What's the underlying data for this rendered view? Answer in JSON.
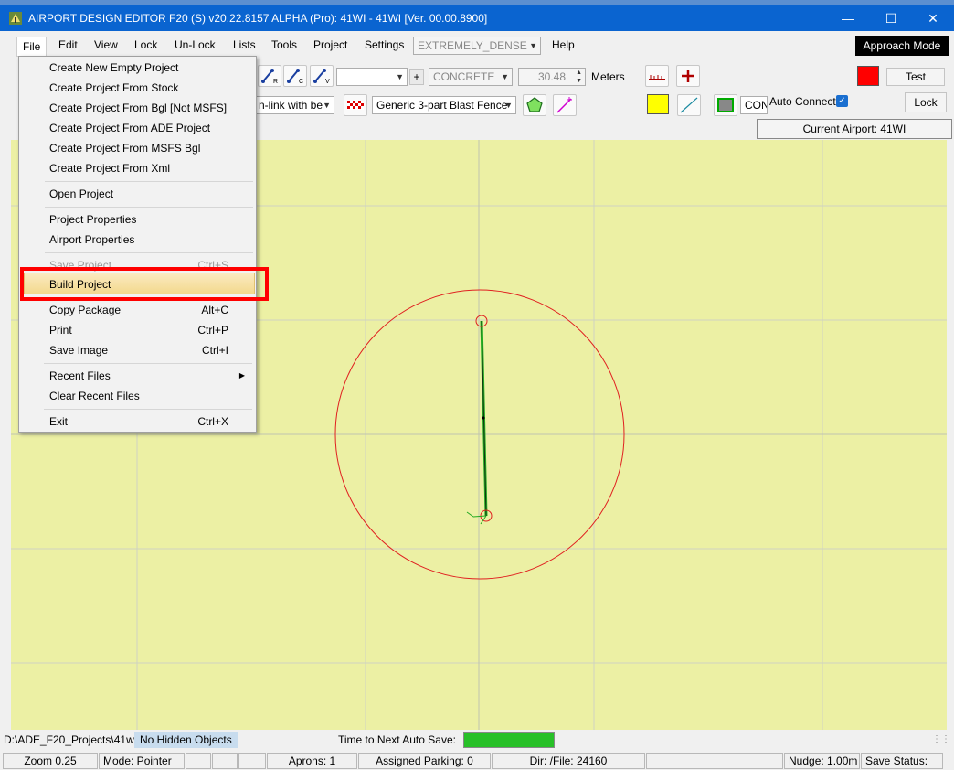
{
  "window": {
    "title": "AIRPORT DESIGN EDITOR F20 (S)  v20.22.8157 ALPHA (Pro): 41WI - 41WI [Ver. 00.00.8900]",
    "minimize": "—",
    "maximize": "☐",
    "close": "✕"
  },
  "menubar": {
    "items": [
      "File",
      "Edit",
      "View",
      "Lock",
      "Un-Lock",
      "Lists",
      "Tools",
      "Project",
      "Settings",
      "Help"
    ],
    "density_value": "EXTREMELY_DENSE",
    "approach_mode": "Approach Mode"
  },
  "toolbar": {
    "link_r": "R",
    "link_c": "C",
    "link_v": "V",
    "plus": "+",
    "surface": "CONCRETE",
    "width_value": "30.48",
    "units": "Meters",
    "test": "Test",
    "unlink_text": "n-link with be",
    "fence_type": "Generic 3-part Blast Fence",
    "con_text": "CONC",
    "auto_connect": "Auto Connect",
    "auto_connect_checked": true,
    "lock": "Lock",
    "current_airport": "Current Airport: 41WI",
    "color_swatch": "#ff0000",
    "yellow_swatch": "#ffff00"
  },
  "file_menu": {
    "items": [
      {
        "label": "Create New Empty Project",
        "shortcut": ""
      },
      {
        "label": "Create Project From Stock",
        "shortcut": ""
      },
      {
        "label": "Create Project From Bgl [Not MSFS]",
        "shortcut": ""
      },
      {
        "label": "Create Project From ADE Project",
        "shortcut": ""
      },
      {
        "label": "Create Project From MSFS Bgl",
        "shortcut": ""
      },
      {
        "label": "Create Project From Xml",
        "shortcut": ""
      },
      {
        "label": "Open Project",
        "shortcut": ""
      },
      {
        "label": "Project Properties",
        "shortcut": ""
      },
      {
        "label": "Airport Properties",
        "shortcut": ""
      },
      {
        "label": "Save  Project",
        "shortcut": "Ctrl+S"
      },
      {
        "label": "Build Project",
        "shortcut": ""
      },
      {
        "label": "Copy Package",
        "shortcut": "Alt+C"
      },
      {
        "label": "Print",
        "shortcut": "Ctrl+P"
      },
      {
        "label": "Save Image",
        "shortcut": "Ctrl+I"
      },
      {
        "label": "Recent Files",
        "shortcut": ""
      },
      {
        "label": "Clear Recent Files",
        "shortcut": ""
      },
      {
        "label": "Exit",
        "shortcut": "Ctrl+X"
      }
    ],
    "highlighted": "Build Project",
    "disabled": "Save  Project"
  },
  "status": {
    "path": "D:\\ADE_F20_Projects\\41wi",
    "hidden": "No Hidden Objects",
    "autosave_label": "Time to Next Auto Save:",
    "autosave_progress": 1.0,
    "zoom": "Zoom 0.25",
    "mode": "Mode: Pointer",
    "aprons": "Aprons: 1",
    "parking": "Assigned Parking: 0",
    "dir": "Dir: /File: 24160",
    "nudge": "Nudge: 1.00m",
    "save_status": "Save Status:"
  },
  "colors": {
    "canvas": "#ecf0a4",
    "runway_line": "#22aa22",
    "circle": "#e02020",
    "highlight_box": "#ff0000",
    "titlebar": "#0a64d0"
  }
}
